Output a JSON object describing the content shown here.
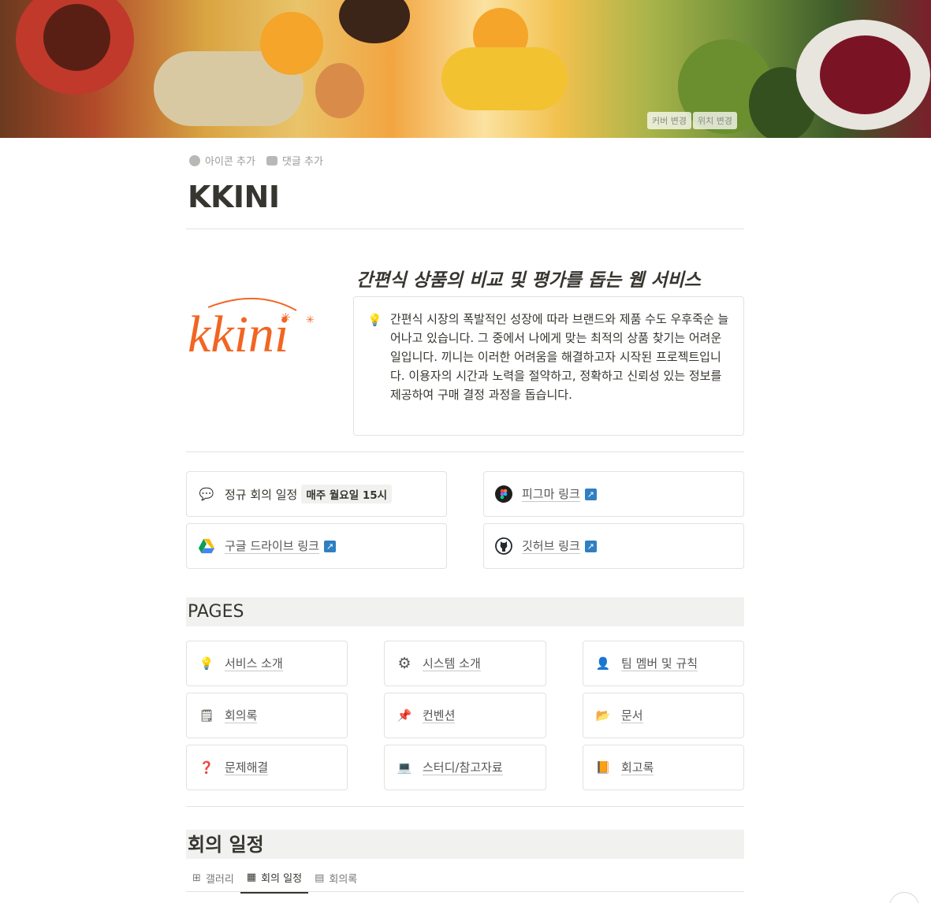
{
  "cover": {
    "change_cover_label": "커버 변경",
    "reposition_label": "위치 변경"
  },
  "page_actions": {
    "add_icon_label": "아이콘 추가",
    "add_comment_label": "댓글 추가"
  },
  "page": {
    "title": "KKINI"
  },
  "intro": {
    "logo_text": "kkini",
    "tagline": "간편식 상품의 비교 및 평가를 돕는 웹 서비스",
    "callout_icon": "lightbulb-icon",
    "callout_text": "간편식 시장의 폭발적인 성장에 따라 브랜드와 제품 수도 우후죽순 늘어나고 있습니다. 그 중에서 나에게 맞는 최적의 상품 찾기는 어려운 일입니다. 끼니는 이러한 어려움을 해결하고자 시작된 프로젝트입니다. 이용자의 시간과 노력을 절약하고, 정확하고 신뢰성 있는 정보를 제공하여 구매 결정 과정을 돕습니다."
  },
  "links": {
    "meeting": {
      "label": "정규 회의 일정",
      "code": "매주 월요일 15시",
      "icon": "speech-bubble-icon"
    },
    "figma": {
      "label": "피그마 링크",
      "icon": "figma-icon"
    },
    "drive": {
      "label": "구글 드라이브 링크",
      "icon": "google-drive-icon"
    },
    "github": {
      "label": "깃허브 링크",
      "icon": "github-icon"
    },
    "external_arrow": "↗"
  },
  "pages_section": {
    "heading": "PAGES",
    "items": [
      {
        "label": "서비스 소개",
        "icon": "lightbulb-icon",
        "glyph": "💡"
      },
      {
        "label": "시스템 소개",
        "icon": "gear-icon",
        "glyph": "⚙"
      },
      {
        "label": "팀 멤버 및 규칙",
        "icon": "person-icon",
        "glyph": "👤"
      },
      {
        "label": "회의록",
        "icon": "notepad-icon",
        "glyph": "🗒"
      },
      {
        "label": "컨벤션",
        "icon": "pushpin-icon",
        "glyph": "📌"
      },
      {
        "label": "문서",
        "icon": "folder-icon",
        "glyph": "📂"
      },
      {
        "label": "문제해결",
        "icon": "question-mark-icon",
        "glyph": "❓"
      },
      {
        "label": "스터디/참고자료",
        "icon": "laptop-icon",
        "glyph": "💻"
      },
      {
        "label": "회고록",
        "icon": "book-icon",
        "glyph": "📙"
      }
    ]
  },
  "meeting_section": {
    "heading": "회의 일정",
    "tabs": [
      {
        "label": "갤러리",
        "icon": "gallery-grid-icon",
        "glyph": "⊞"
      },
      {
        "label": "회의 일정",
        "icon": "calendar-icon",
        "glyph": "▦"
      },
      {
        "label": "회의록",
        "icon": "table-icon",
        "glyph": "▤"
      }
    ]
  }
}
